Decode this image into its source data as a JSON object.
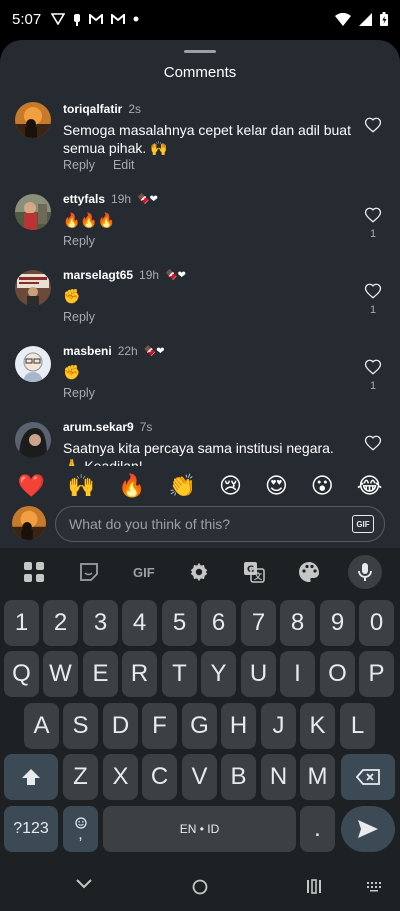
{
  "status_bar": {
    "time": "5:07"
  },
  "sheet": {
    "title": "Comments"
  },
  "comments": [
    {
      "username": "toriqalfatir",
      "time": "2s",
      "text": "Semoga masalahnya cepet kelar dan adil buat semua pihak. 🙌",
      "reply": "Reply",
      "edit": "Edit",
      "likes": ""
    },
    {
      "username": "ettyfals",
      "time": "19h",
      "badge": "🍫❤",
      "text": "🔥🔥🔥",
      "reply": "Reply",
      "likes": "1"
    },
    {
      "username": "marselagt65",
      "time": "19h",
      "badge": "🍫❤",
      "text": "✊",
      "reply": "Reply",
      "likes": "1"
    },
    {
      "username": "masbeni",
      "time": "22h",
      "badge": "🍫❤",
      "text": "✊",
      "reply": "Reply",
      "likes": "1"
    },
    {
      "username": "arum.sekar9",
      "time": "7s",
      "text": "Saatnya kita percaya sama institusi negara. 🙏 Keadilan!",
      "likes": ""
    }
  ],
  "emoji_bar": [
    "❤️",
    "🙌",
    "🔥",
    "👏",
    "😢",
    "😍",
    "😮",
    "😂"
  ],
  "input": {
    "placeholder": "What do you think of this?",
    "gif_label": "GIF"
  },
  "keyboard": {
    "toolbar_gif": "GIF",
    "row_numbers": [
      "1",
      "2",
      "3",
      "4",
      "5",
      "6",
      "7",
      "8",
      "9",
      "0"
    ],
    "row_q": [
      "Q",
      "W",
      "E",
      "R",
      "T",
      "Y",
      "U",
      "I",
      "O",
      "P"
    ],
    "row_a": [
      "A",
      "S",
      "D",
      "F",
      "G",
      "H",
      "J",
      "K",
      "L"
    ],
    "row_z": [
      "Z",
      "X",
      "C",
      "V",
      "B",
      "N",
      "M"
    ],
    "symbols_label": "?123",
    "space_label": "EN • ID",
    "comma": ",",
    "period": "."
  },
  "icons": {
    "status_left": [
      "signal-triangle-icon",
      "fist-icon",
      "gmail-icon",
      "gmail-icon",
      "dot-icon"
    ],
    "status_right": [
      "wifi-icon",
      "signal-icon",
      "battery-icon"
    ],
    "keyboard_toolbar": [
      "apps-grid-icon",
      "sticker-icon",
      "gif-icon",
      "gear-icon",
      "translate-icon",
      "palette-icon",
      "mic-icon"
    ]
  }
}
